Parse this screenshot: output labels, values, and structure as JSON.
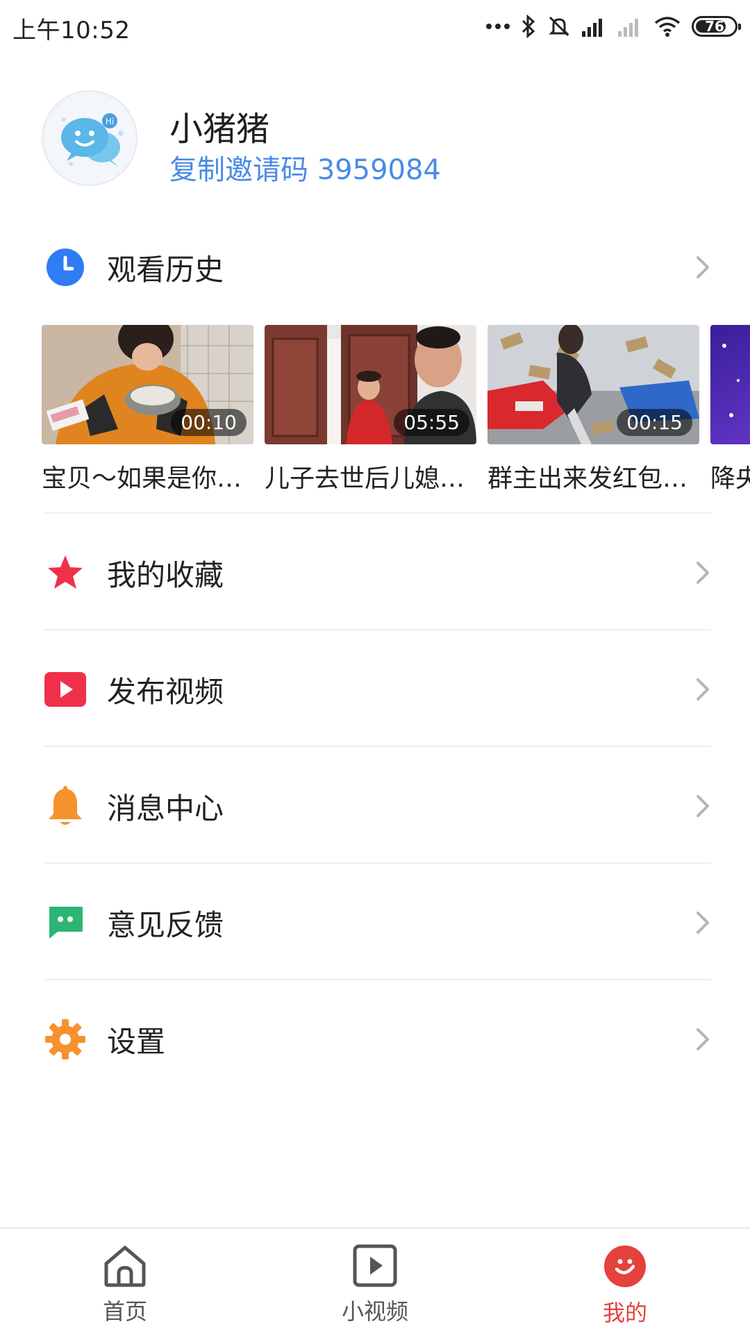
{
  "status_bar": {
    "time": "上午10:52",
    "battery": "76"
  },
  "profile": {
    "username": "小猪猪",
    "invite_label": "复制邀请码",
    "invite_code": "3959084"
  },
  "history": {
    "label": "观看历史",
    "videos": [
      {
        "title": "宝贝～如果是你会跪下来吃吗",
        "duration": "00:10"
      },
      {
        "title": "儿子去世后儿媳妇...",
        "duration": "05:55"
      },
      {
        "title": "群主出来发红包了...",
        "duration": "00:15"
      },
      {
        "title": "降央卓玛",
        "duration": ""
      }
    ]
  },
  "menu": {
    "favorites": "我的收藏",
    "publish": "发布视频",
    "messages": "消息中心",
    "feedback": "意见反馈",
    "settings": "设置"
  },
  "bottom_nav": {
    "home": "首页",
    "short_video": "小视频",
    "mine": "我的"
  },
  "colors": {
    "accent": "#e5413d",
    "link": "#4a8ae6",
    "history_icon": "#2f7cf6",
    "favorites_icon": "#f0304a",
    "publish_icon": "#f0304a",
    "messages_icon": "#f5922e",
    "feedback_icon": "#2bb673",
    "settings_icon": "#f5922e"
  }
}
